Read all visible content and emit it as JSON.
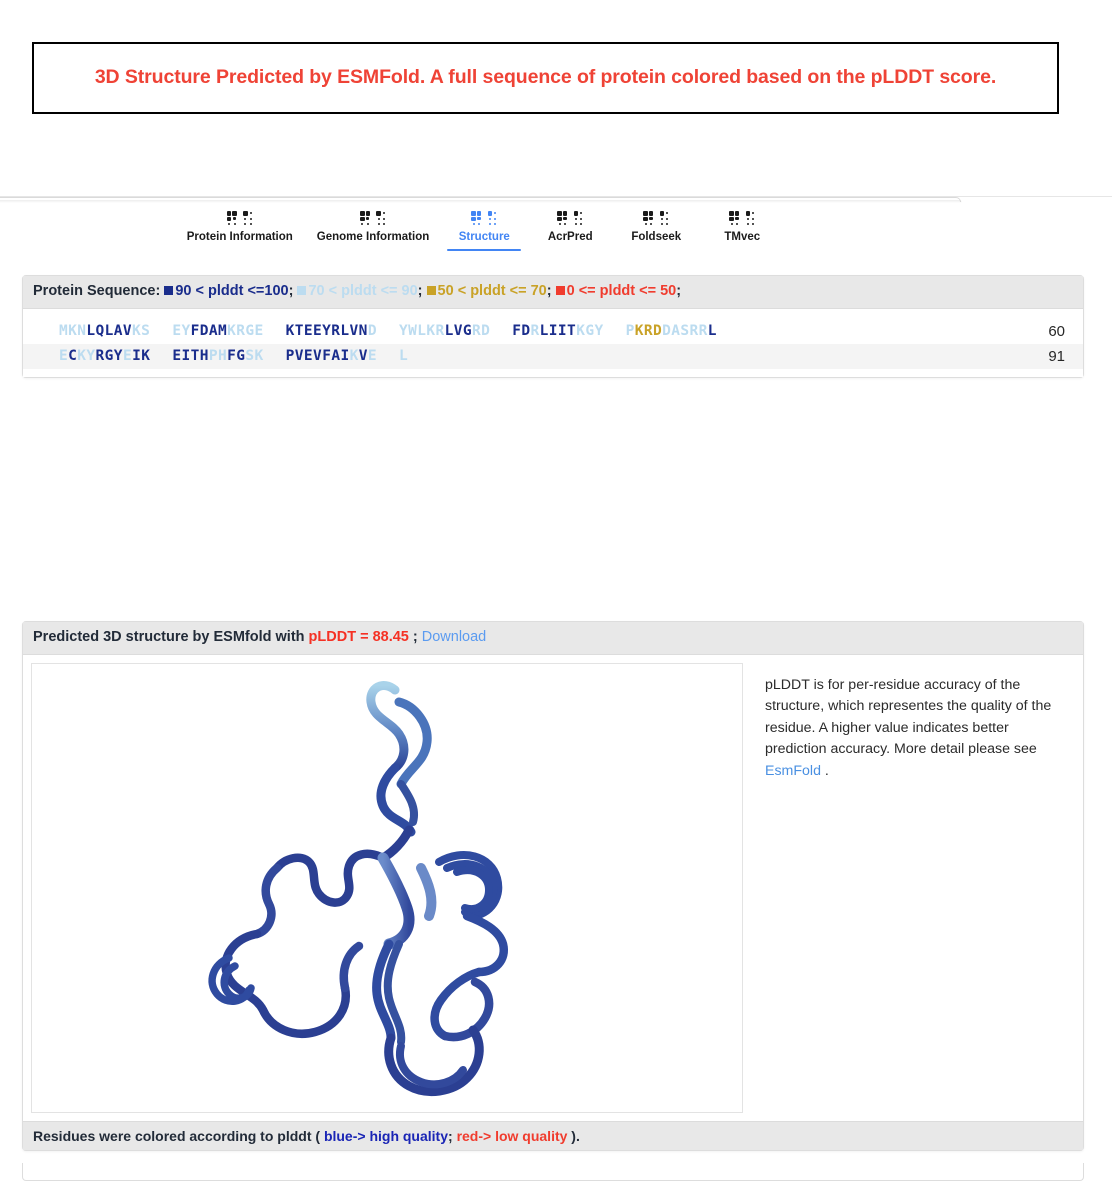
{
  "banner": {
    "title": "3D Structure Predicted by ESMFold. A full sequence of protein colored based on the pLDDT score.",
    "text_color": "#ef4336",
    "border_color": "#000000"
  },
  "tabs": {
    "items": [
      {
        "label": "Protein Information",
        "icon": "dot-matrix-icon",
        "active": false
      },
      {
        "label": "Genome Information",
        "icon": "dot-matrix-icon",
        "active": false
      },
      {
        "label": "Structure",
        "icon": "dot-matrix-icon",
        "active": true
      },
      {
        "label": "AcrPred",
        "icon": "dot-matrix-icon",
        "active": false
      },
      {
        "label": "Foldseek",
        "icon": "dot-matrix-icon",
        "active": false
      },
      {
        "label": "TMvec",
        "icon": "dot-matrix-icon",
        "active": false
      }
    ],
    "active_color": "#4285f4"
  },
  "sequence_card": {
    "header_label": "Protein Sequence:",
    "legend": [
      {
        "text": "90 < plddt <=100",
        "color": "#1a2d8c"
      },
      {
        "text": "70 < plddt <= 90",
        "color": "#bcdcf0"
      },
      {
        "text": "50 < plddt <= 70",
        "color": "#c9a227"
      },
      {
        "text": "0 <= plddt <= 50",
        "color": "#f03c2e"
      }
    ],
    "separator": ";",
    "rows": [
      {
        "index": "60",
        "chunks": [
          [
            {
              "t": "MKN",
              "c": "high"
            },
            {
              "t": "LQ",
              "c": "very-high"
            },
            {
              "t": "LAV",
              "c": "very-high"
            },
            {
              "t": "KS",
              "c": "high"
            }
          ],
          [
            {
              "t": "EY",
              "c": "high"
            },
            {
              "t": "FDAM",
              "c": "very-high"
            },
            {
              "t": "KRG",
              "c": "high"
            },
            {
              "t": "E",
              "c": "high"
            }
          ],
          [
            {
              "t": "KTEEYRLVN",
              "c": "very-high"
            },
            {
              "t": "D",
              "c": "high"
            }
          ],
          [
            {
              "t": "YWL",
              "c": "high"
            },
            {
              "t": "KR",
              "c": "high"
            },
            {
              "t": "LVG",
              "c": "very-high"
            },
            {
              "t": "RD",
              "c": "high"
            }
          ],
          [
            {
              "t": "FD",
              "c": "very-high"
            },
            {
              "t": "R",
              "c": "high"
            },
            {
              "t": "LIIT",
              "c": "very-high"
            },
            {
              "t": "KGY",
              "c": "high"
            }
          ],
          [
            {
              "t": "P",
              "c": "high"
            },
            {
              "t": "KRD",
              "c": "medium"
            },
            {
              "t": "DASRR",
              "c": "high"
            },
            {
              "t": "L",
              "c": "very-high"
            }
          ]
        ]
      },
      {
        "index": "91",
        "chunks": [
          [
            {
              "t": "E",
              "c": "high"
            },
            {
              "t": "C",
              "c": "very-high"
            },
            {
              "t": "KY",
              "c": "high"
            },
            {
              "t": "RGY",
              "c": "very-high"
            },
            {
              "t": "E",
              "c": "high"
            },
            {
              "t": "IK",
              "c": "very-high"
            }
          ],
          [
            {
              "t": "EITH",
              "c": "very-high"
            },
            {
              "t": "PH",
              "c": "high"
            },
            {
              "t": "FG",
              "c": "very-high"
            },
            {
              "t": "SK",
              "c": "high"
            }
          ],
          [
            {
              "t": "PVEVFAI",
              "c": "very-high"
            },
            {
              "t": "K",
              "c": "high"
            },
            {
              "t": "V",
              "c": "very-high"
            },
            {
              "t": "E",
              "c": "high"
            }
          ],
          [
            {
              "t": "L",
              "c": "high"
            }
          ]
        ]
      }
    ]
  },
  "structure_card": {
    "header_prefix": "Predicted 3D structure by ESMfold with ",
    "header_plddt": "pLDDT = 88.45",
    "header_mid": " ; ",
    "header_download": "Download",
    "plddt_note": {
      "text": "pLDDT is for per-residue accuracy of the structure, which representes the quality of the residue. A higher value indicates better prediction accuracy. More detail please see ",
      "link": "EsmFold",
      "suffix": " ."
    },
    "footer": {
      "prefix": "Residues were colored according to plddt ( ",
      "blue": "blue-> high quality",
      "mid": "; ",
      "red": "red-> low quality",
      "suffix": " )."
    },
    "viewer": {
      "representation": "cartoon-ribbon",
      "dominant_color": "#2c4496",
      "terminus_color": "#9fcbe8"
    }
  }
}
